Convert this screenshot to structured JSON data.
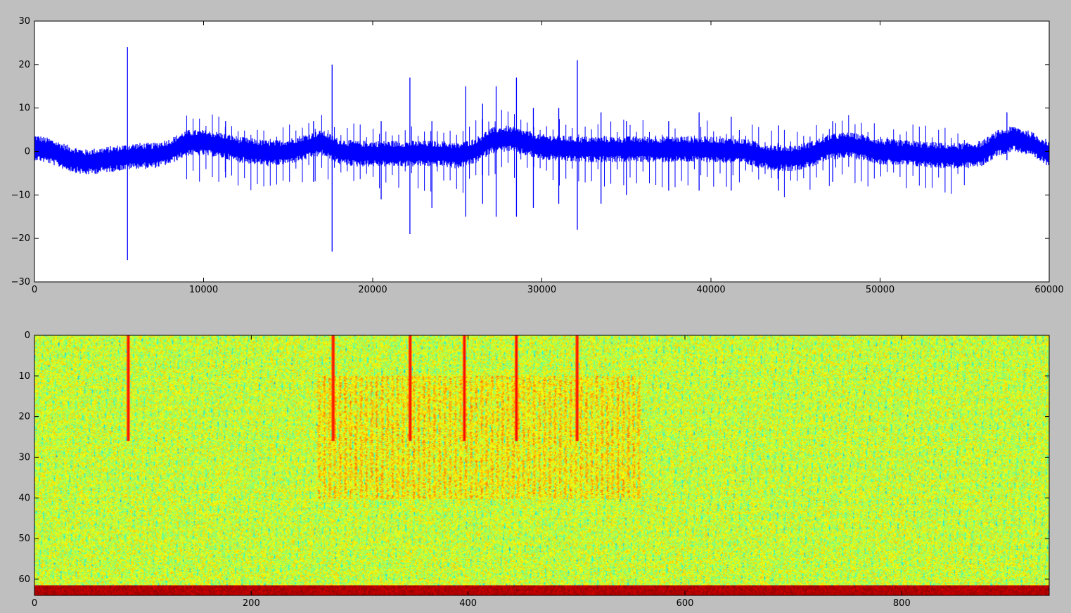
{
  "figure": {
    "background": "#bfbfbf"
  },
  "chart_data": [
    {
      "type": "line",
      "title": "",
      "xlabel": "",
      "ylabel": "",
      "xlim": [
        0,
        60000
      ],
      "ylim": [
        -30,
        30
      ],
      "xticks": [
        0,
        10000,
        20000,
        30000,
        40000,
        50000,
        60000
      ],
      "yticks": [
        30,
        20,
        10,
        0,
        -10,
        -20,
        -30
      ],
      "xtick_labels": [
        "0",
        "10000",
        "20000",
        "30000",
        "40000",
        "50000",
        "60000"
      ],
      "ytick_labels": [
        "30",
        "20",
        "10",
        "0",
        "−10",
        "−20",
        "−30"
      ],
      "grid": false,
      "series": [
        {
          "color": "#0000ff",
          "baseline": [
            [
              0,
              1
            ],
            [
              1000,
              0
            ],
            [
              2000,
              -1.5
            ],
            [
              3000,
              -2.5
            ],
            [
              4000,
              -2
            ],
            [
              5000,
              -1.5
            ],
            [
              6000,
              -1
            ],
            [
              7000,
              -1
            ],
            [
              8000,
              0
            ],
            [
              9000,
              2
            ],
            [
              10000,
              2
            ],
            [
              11000,
              1.5
            ],
            [
              12000,
              0.5
            ],
            [
              13000,
              0
            ],
            [
              14000,
              -0.5
            ],
            [
              15000,
              0
            ],
            [
              16000,
              1
            ],
            [
              17000,
              2
            ],
            [
              18000,
              0
            ],
            [
              19000,
              -0.5
            ],
            [
              20000,
              -0.5
            ],
            [
              22000,
              -0.5
            ],
            [
              24000,
              -0.5
            ],
            [
              25000,
              -1
            ],
            [
              26000,
              0
            ],
            [
              27000,
              2.5
            ],
            [
              28000,
              3
            ],
            [
              29000,
              2
            ],
            [
              30000,
              1
            ],
            [
              32000,
              0.5
            ],
            [
              34000,
              0.5
            ],
            [
              36000,
              0.5
            ],
            [
              38000,
              0.5
            ],
            [
              40000,
              0.5
            ],
            [
              42000,
              0
            ],
            [
              43000,
              -1
            ],
            [
              44000,
              -1.5
            ],
            [
              45000,
              -1.5
            ],
            [
              46000,
              -0.5
            ],
            [
              47000,
              1
            ],
            [
              48000,
              1.5
            ],
            [
              49000,
              1
            ],
            [
              50000,
              0
            ],
            [
              52000,
              -0.5
            ],
            [
              54000,
              -1
            ],
            [
              55000,
              -1
            ],
            [
              56000,
              -0.5
            ],
            [
              57000,
              2
            ],
            [
              58000,
              3
            ],
            [
              59000,
              1.5
            ],
            [
              60000,
              -0.5
            ]
          ],
          "noise_amplitude": 2.5,
          "spikes": [
            {
              "x": 5500,
              "max": 24,
              "min": -25
            },
            {
              "x": 17600,
              "max": 20,
              "min": -23
            },
            {
              "x": 22200,
              "max": 17,
              "min": -19
            },
            {
              "x": 25500,
              "max": 15,
              "min": -15
            },
            {
              "x": 27300,
              "max": 15,
              "min": -15
            },
            {
              "x": 28500,
              "max": 17,
              "min": -15
            },
            {
              "x": 32100,
              "max": 21,
              "min": -18
            },
            {
              "x": 11300,
              "max": 7,
              "min": -6
            },
            {
              "x": 16500,
              "max": 7,
              "min": -7
            },
            {
              "x": 20500,
              "max": 7,
              "min": -11
            },
            {
              "x": 23500,
              "max": 7,
              "min": -13
            },
            {
              "x": 26500,
              "max": 11,
              "min": -12
            },
            {
              "x": 29500,
              "max": 10,
              "min": -13
            },
            {
              "x": 31000,
              "max": 10,
              "min": -12
            },
            {
              "x": 33500,
              "max": 9,
              "min": -12
            },
            {
              "x": 35000,
              "max": 7,
              "min": -10
            },
            {
              "x": 37500,
              "max": 7,
              "min": -9
            },
            {
              "x": 39300,
              "max": 9,
              "min": -9
            },
            {
              "x": 41200,
              "max": 8,
              "min": -9
            },
            {
              "x": 44000,
              "max": 6,
              "min": -9
            },
            {
              "x": 47200,
              "max": 7,
              "min": -7
            },
            {
              "x": 57500,
              "max": 9,
              "min": -2
            }
          ],
          "regular_spike_interval": 380,
          "regular_spike_range": [
            9000,
            55000
          ]
        }
      ]
    },
    {
      "type": "heatmap",
      "title": "",
      "xlabel": "",
      "ylabel": "",
      "xlim": [
        0,
        936
      ],
      "ylim": [
        64,
        0
      ],
      "xticks": [
        0,
        200,
        400,
        600,
        800
      ],
      "yticks": [
        0,
        10,
        20,
        30,
        40,
        50,
        60
      ],
      "xtick_labels": [
        "0",
        "200",
        "400",
        "600",
        "800"
      ],
      "ytick_labels": [
        "0",
        "10",
        "20",
        "30",
        "40",
        "50",
        "60"
      ],
      "colormap": "jet",
      "columns": 936,
      "rows": 64,
      "background_level": 0.58,
      "bottom_band": {
        "rows": [
          61.5,
          64
        ],
        "level": 0.95
      },
      "vertical_streaks": [
        86,
        275,
        346,
        396,
        444,
        500
      ],
      "mid_band_region": {
        "x": [
          260,
          560
        ],
        "rows": [
          10,
          40
        ],
        "boost": 0.1
      }
    }
  ]
}
